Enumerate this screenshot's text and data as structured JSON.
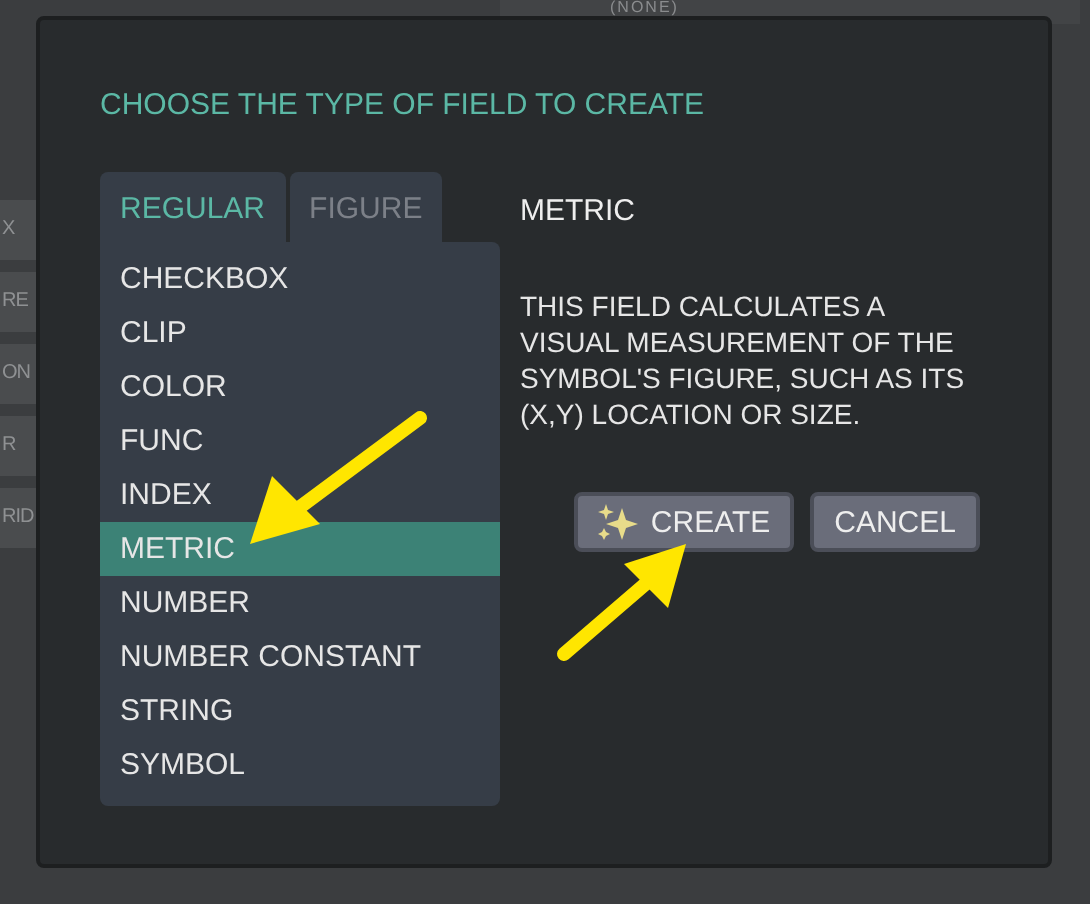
{
  "background": {
    "top_label": "(NONE)",
    "side_labels": [
      "X",
      "RE",
      "ON",
      "R",
      "RID"
    ]
  },
  "dialog": {
    "title": "CHOOSE THE TYPE OF FIELD TO CREATE",
    "tabs": [
      {
        "label": "REGULAR",
        "selected": true
      },
      {
        "label": "FIGURE",
        "selected": false
      }
    ],
    "field_types": [
      {
        "label": "CHECKBOX",
        "selected": false
      },
      {
        "label": "CLIP",
        "selected": false
      },
      {
        "label": "COLOR",
        "selected": false
      },
      {
        "label": "FUNC",
        "selected": false
      },
      {
        "label": "INDEX",
        "selected": false
      },
      {
        "label": "METRIC",
        "selected": true
      },
      {
        "label": "NUMBER",
        "selected": false
      },
      {
        "label": "NUMBER CONSTANT",
        "selected": false
      },
      {
        "label": "STRING",
        "selected": false
      },
      {
        "label": "SYMBOL",
        "selected": false
      }
    ],
    "detail": {
      "name": "METRIC",
      "description": "THIS FIELD CALCULATES A VISUAL MEASUREMENT OF THE SYMBOL'S FIGURE, SUCH AS ITS (X,Y) LOCATION OR SIZE."
    },
    "buttons": [
      {
        "label": "CREATE",
        "kind": "create"
      },
      {
        "label": "CANCEL",
        "kind": "cancel"
      }
    ]
  }
}
